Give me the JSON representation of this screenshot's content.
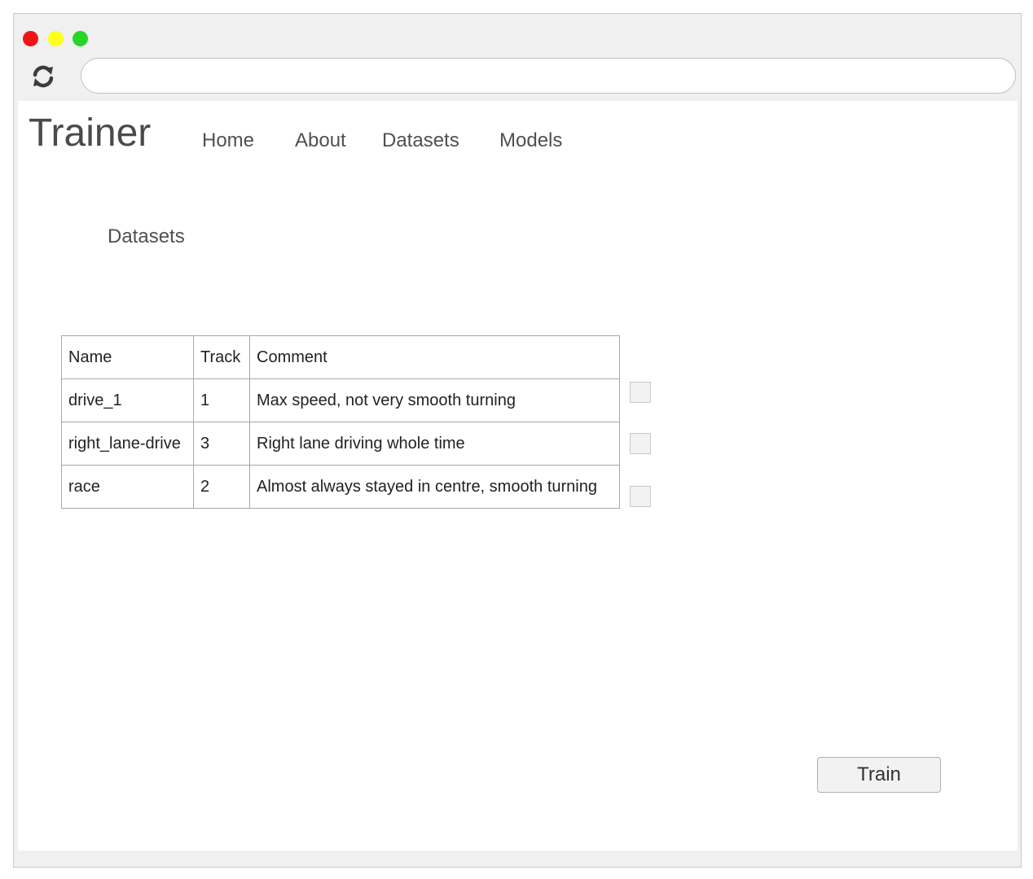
{
  "window": {
    "controls": {
      "close_color": "#f21414",
      "minimize_color": "#ffff1a",
      "maximize_color": "#26d626"
    },
    "reload_icon": "reload-icon",
    "url": ""
  },
  "app": {
    "brand": "Trainer"
  },
  "nav": [
    {
      "label": "Home"
    },
    {
      "label": "About"
    },
    {
      "label": "Datasets"
    },
    {
      "label": "Models"
    }
  ],
  "page": {
    "section_title": "Datasets"
  },
  "table": {
    "headers": [
      "Name",
      "Track",
      "Comment"
    ],
    "rows": [
      {
        "name": "drive_1",
        "track": "1",
        "comment": "Max speed, not very smooth turning",
        "selected": false
      },
      {
        "name": "right_lane-drive",
        "track": "3",
        "comment": "Right lane driving whole time",
        "selected": false
      },
      {
        "name": "race",
        "track": "2",
        "comment": "Almost always stayed in centre, smooth turning",
        "selected": false
      }
    ]
  },
  "actions": {
    "train_label": "Train"
  }
}
